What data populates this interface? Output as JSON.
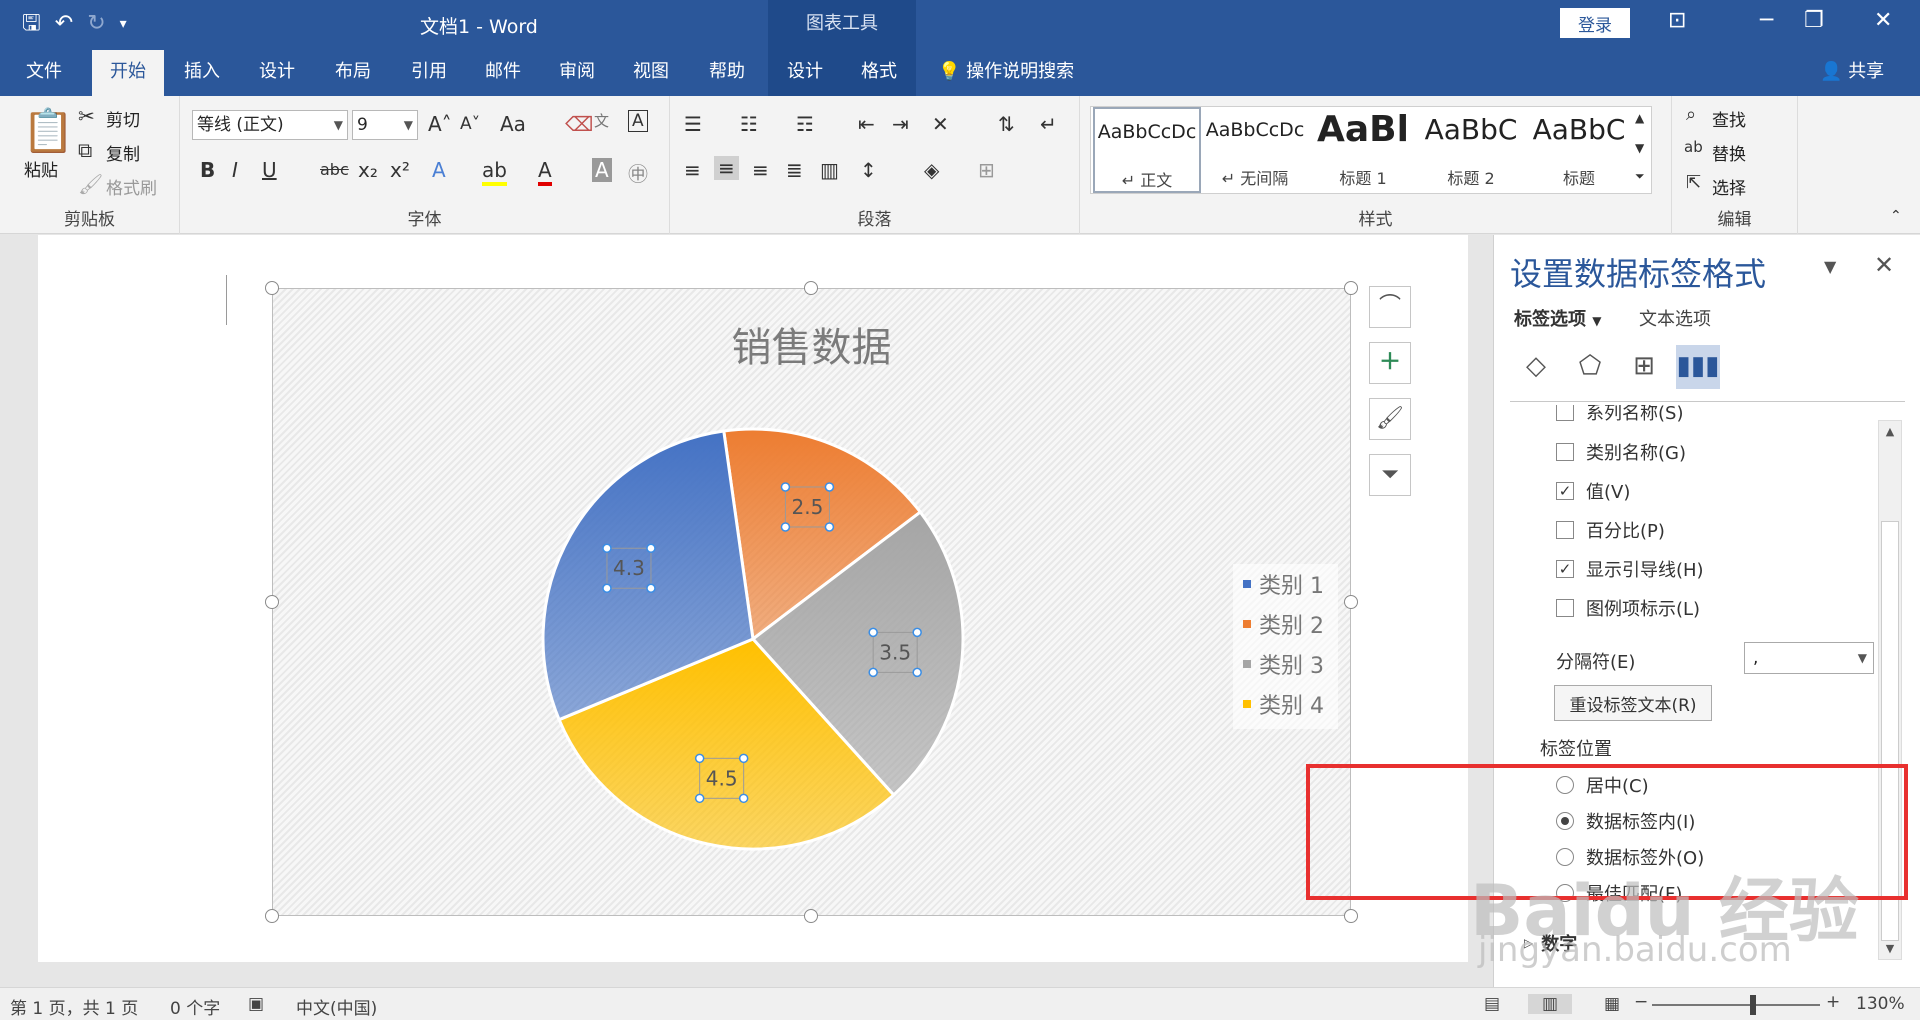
{
  "titlebar": {
    "doc_title": "文档1  -  Word",
    "chart_tools": "图表工具",
    "login": "登录",
    "icons": [
      "save-icon",
      "undo-icon",
      "redo-icon",
      "customize-qat-icon"
    ]
  },
  "tabs": [
    {
      "label": "文件"
    },
    {
      "label": "开始"
    },
    {
      "label": "插入"
    },
    {
      "label": "设计"
    },
    {
      "label": "布局"
    },
    {
      "label": "引用"
    },
    {
      "label": "邮件"
    },
    {
      "label": "审阅"
    },
    {
      "label": "视图"
    },
    {
      "label": "帮助"
    },
    {
      "label": "设计"
    },
    {
      "label": "格式"
    }
  ],
  "active_tab": "开始",
  "search_label": "操作说明搜索",
  "share_label": "共享",
  "ribbon": {
    "clipboard": {
      "paste": "粘贴",
      "cut": "剪切",
      "copy": "复制",
      "format_painter": "格式刷",
      "label": "剪贴板"
    },
    "font": {
      "name": "等线 (正文)",
      "size": "9",
      "label": "字体"
    },
    "paragraph": {
      "label": "段落"
    },
    "styles": {
      "label": "样式",
      "items": [
        {
          "preview": "AaBbCcDc",
          "name": "↵ 正文"
        },
        {
          "preview": "AaBbCcDc",
          "name": "↵ 无间隔"
        },
        {
          "preview": "AaBl",
          "name": "标题 1"
        },
        {
          "preview": "AaBbC",
          "name": "标题 2"
        },
        {
          "preview": "AaBbC",
          "name": "标题"
        }
      ]
    },
    "editing": {
      "find": "查找",
      "replace": "替换",
      "select": "选择",
      "label": "编辑"
    }
  },
  "chart_data": {
    "type": "pie",
    "title": "销售数据",
    "categories": [
      "类别 1",
      "类别 2",
      "类别 3",
      "类别 4"
    ],
    "values": [
      4.3,
      2.5,
      3.5,
      4.5
    ],
    "colors": [
      "#4472c4",
      "#ed7d31",
      "#a5a5a5",
      "#ffc000"
    ],
    "legend_position": "right",
    "data_labels": true
  },
  "pane": {
    "title": "设置数据标签格式",
    "tabs": [
      "标签选项",
      "文本选项"
    ],
    "icons": [
      "fill-line-icon",
      "effects-icon",
      "size-properties-icon",
      "label-options-icon"
    ],
    "options": [
      {
        "label": "系列名称(S)",
        "checked": false
      },
      {
        "label": "类别名称(G)",
        "checked": false
      },
      {
        "label": "值(V)",
        "checked": true
      },
      {
        "label": "百分比(P)",
        "checked": false
      },
      {
        "label": "显示引导线(H)",
        "checked": true
      },
      {
        "label": "图例项标示(L)",
        "checked": false
      }
    ],
    "separator_label": "分隔符(E)",
    "separator_value": ",",
    "reset_button": "重设标签文本(R)",
    "position_label": "标签位置",
    "positions": [
      {
        "label": "居中(C)",
        "selected": false
      },
      {
        "label": "数据标签内(I)",
        "selected": true
      },
      {
        "label": "数据标签外(O)",
        "selected": false
      },
      {
        "label": "最佳匹配(F)",
        "selected": false
      }
    ],
    "number_section": "数字"
  },
  "statusbar": {
    "page": "第 1 页，共 1 页",
    "words": "0 个字",
    "language": "中文(中国)",
    "zoom": "130%"
  },
  "watermark": {
    "main": "Baidu 经验",
    "url": "jingyan.baidu.com"
  }
}
